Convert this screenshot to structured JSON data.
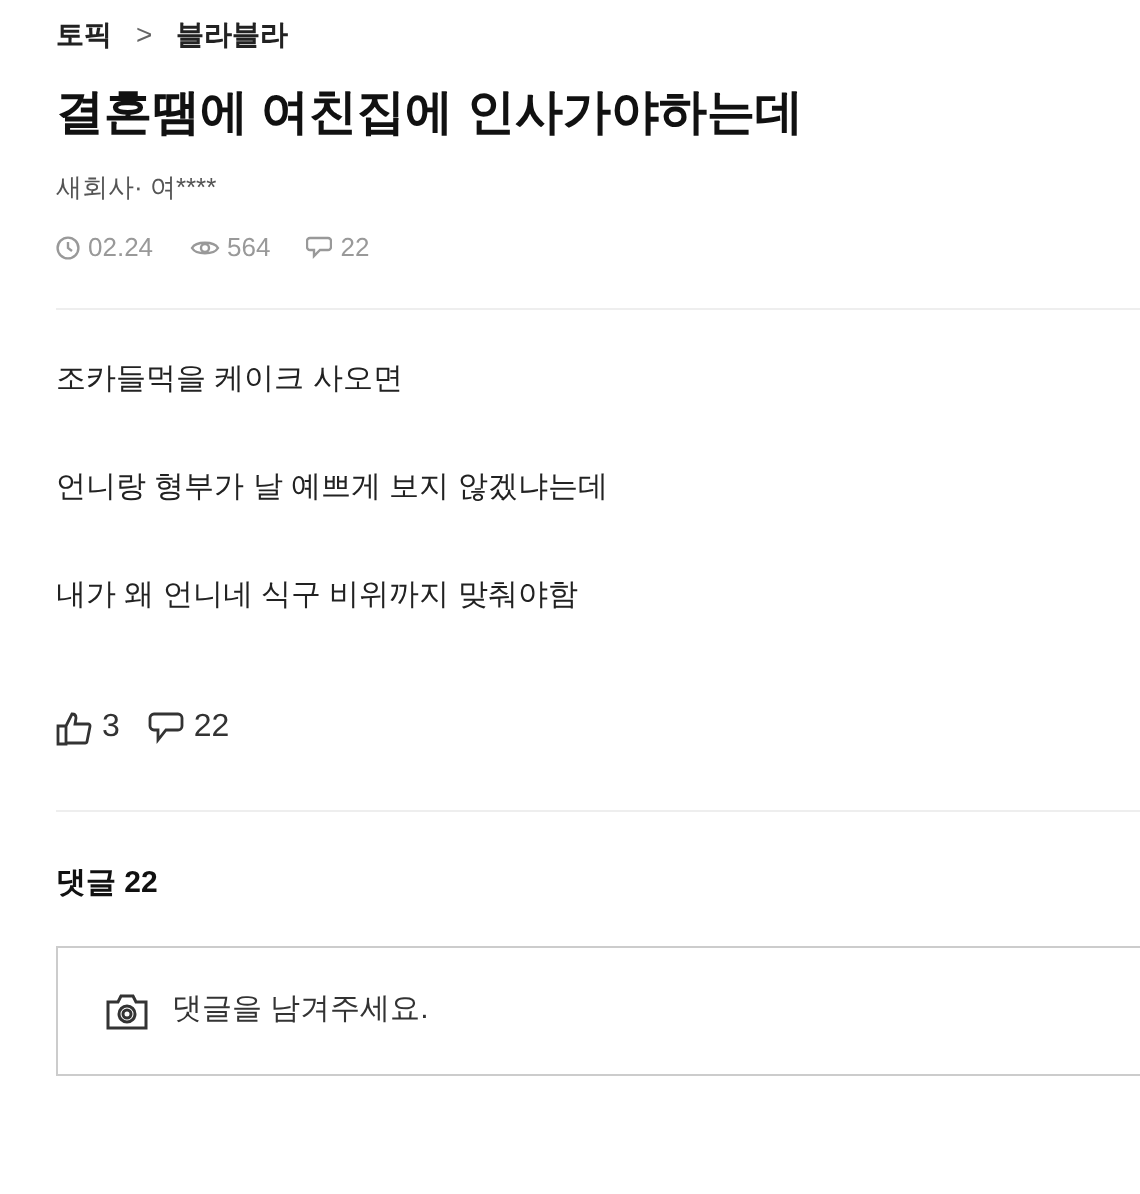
{
  "breadcrumb": {
    "topic": "토픽",
    "separator": ">",
    "board": "블라블라"
  },
  "title": "결혼땜에 여친집에 인사가야하는데",
  "author": "새회사· 여****",
  "meta": {
    "date": "02.24",
    "views": "564",
    "comments": "22"
  },
  "body": [
    "조카들먹을 케이크 사오면",
    "언니랑 형부가 날 예쁘게 보지 않겠냐는데",
    "내가 왜 언니네 식구 비위까지 맞춰야함"
  ],
  "reactions": {
    "likes": "3",
    "comments": "22"
  },
  "comments_header": "댓글 22",
  "comment_field": {
    "placeholder": "댓글을 남겨주세요."
  }
}
